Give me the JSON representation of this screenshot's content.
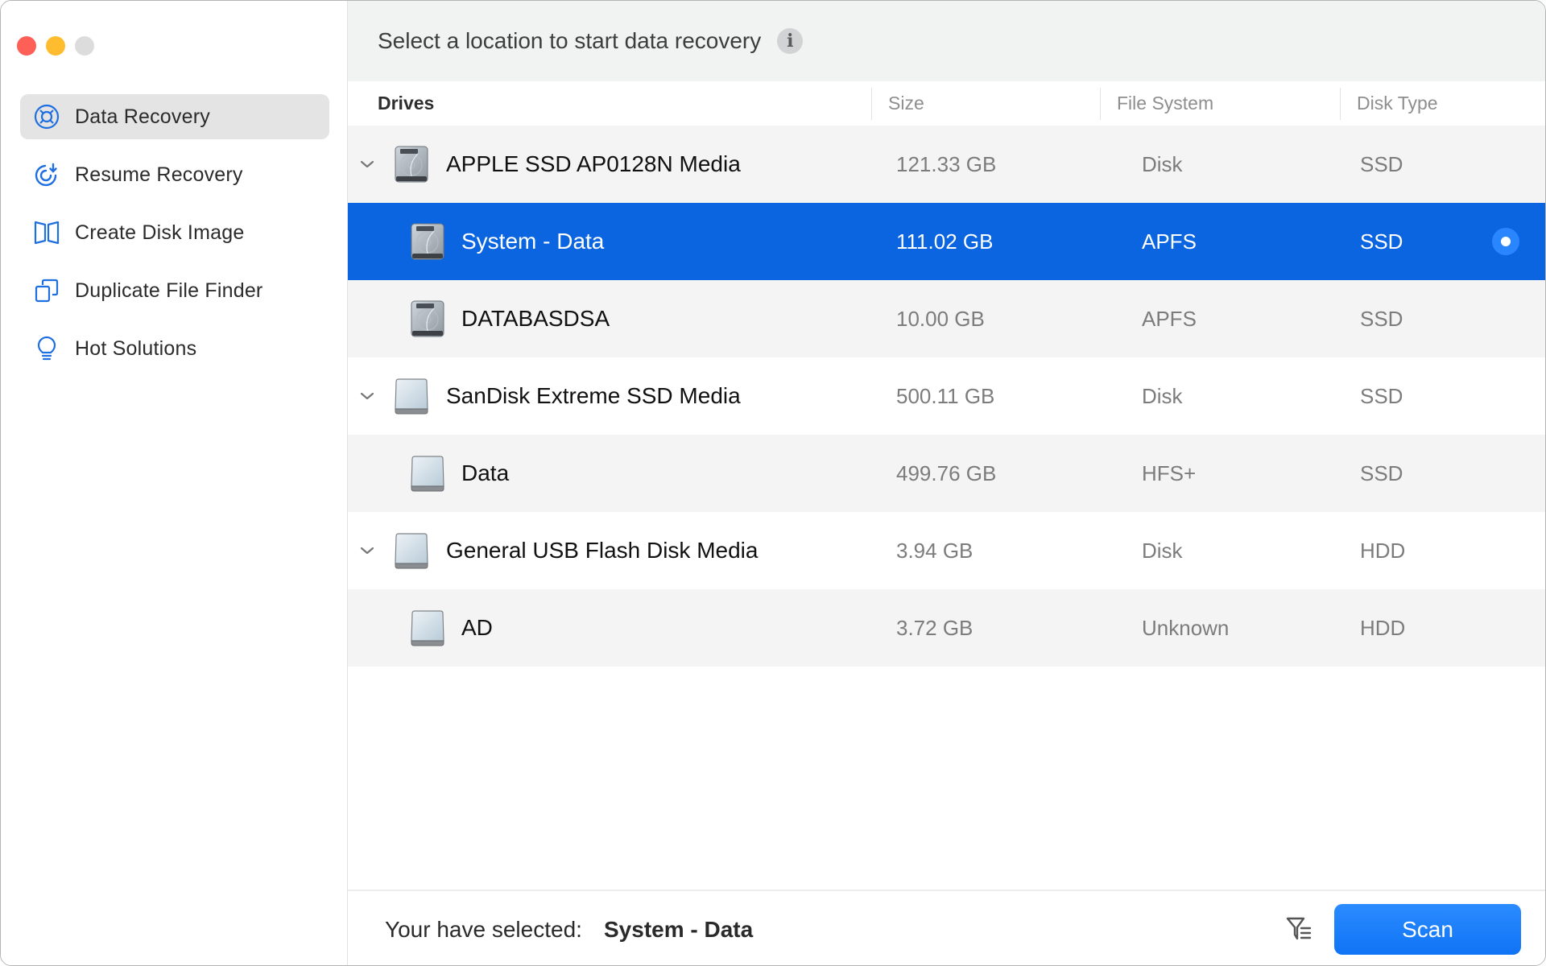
{
  "window": {
    "traffic_lights": [
      "close",
      "minimize",
      "zoom"
    ]
  },
  "sidebar": {
    "items": [
      {
        "label": "Data Recovery",
        "icon": "lifebuoy-icon",
        "active": true
      },
      {
        "label": "Resume Recovery",
        "icon": "resume-icon",
        "active": false
      },
      {
        "label": "Create Disk Image",
        "icon": "disk-image-icon",
        "active": false
      },
      {
        "label": "Duplicate File Finder",
        "icon": "duplicate-icon",
        "active": false
      },
      {
        "label": "Hot Solutions",
        "icon": "lightbulb-icon",
        "active": false
      }
    ]
  },
  "header": {
    "title": "Select a location to start data recovery",
    "info_icon": "i"
  },
  "table": {
    "columns": {
      "drives": "Drives",
      "size": "Size",
      "file_system": "File System",
      "disk_type": "Disk Type"
    },
    "rows": [
      {
        "name": "APPLE SSD AP0128N Media",
        "size": "121.33 GB",
        "file_system": "Disk",
        "disk_type": "SSD",
        "level": "parent",
        "icon": "internal-disk-icon",
        "selected": false
      },
      {
        "name": "System - Data",
        "size": "111.02 GB",
        "file_system": "APFS",
        "disk_type": "SSD",
        "level": "child",
        "icon": "internal-disk-icon",
        "selected": true
      },
      {
        "name": "DATABASDSA",
        "size": "10.00 GB",
        "file_system": "APFS",
        "disk_type": "SSD",
        "level": "child",
        "icon": "internal-disk-icon",
        "selected": false
      },
      {
        "name": "SanDisk Extreme SSD Media",
        "size": "500.11 GB",
        "file_system": "Disk",
        "disk_type": "SSD",
        "level": "parent",
        "icon": "external-disk-icon",
        "selected": false
      },
      {
        "name": "Data",
        "size": "499.76 GB",
        "file_system": "HFS+",
        "disk_type": "SSD",
        "level": "child",
        "icon": "external-disk-icon",
        "selected": false
      },
      {
        "name": "General USB Flash Disk Media",
        "size": "3.94 GB",
        "file_system": "Disk",
        "disk_type": "HDD",
        "level": "parent",
        "icon": "external-disk-icon",
        "selected": false
      },
      {
        "name": "AD",
        "size": "3.72 GB",
        "file_system": "Unknown",
        "disk_type": "HDD",
        "level": "child",
        "icon": "external-disk-icon",
        "selected": false
      }
    ]
  },
  "footer": {
    "selected_label": "Your have selected:",
    "selected_value": "System - Data",
    "scan_label": "Scan"
  },
  "colors": {
    "accent": "#0b65e1",
    "scan_button": "#1a7df8",
    "sidebar_icon": "#1f6fe0"
  }
}
